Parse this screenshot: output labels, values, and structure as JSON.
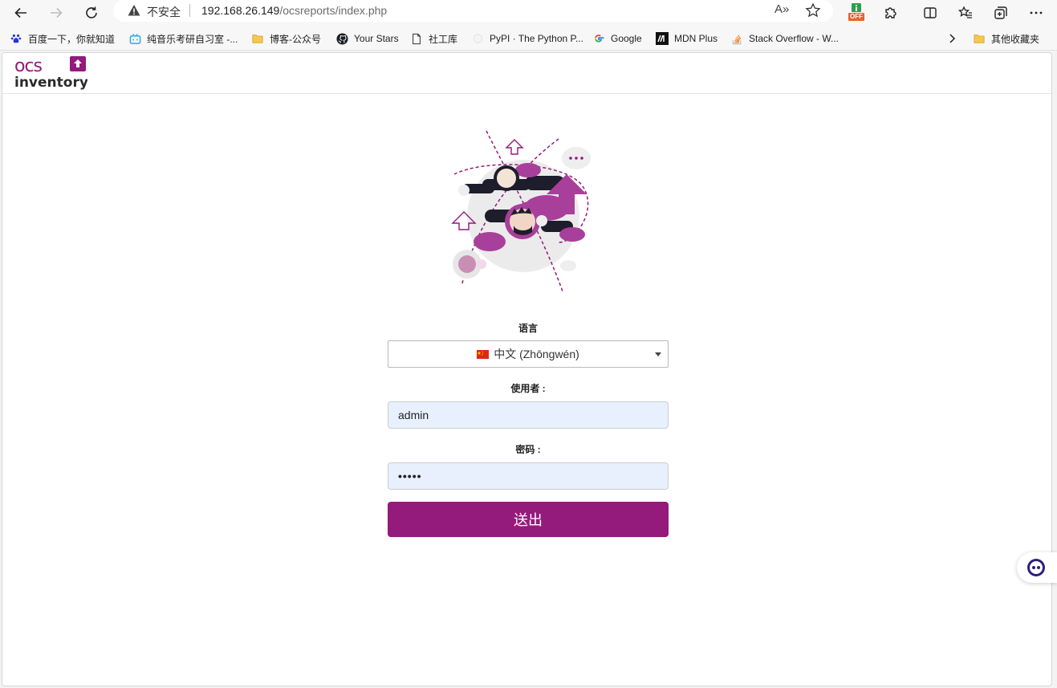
{
  "browser": {
    "security_label": "不安全",
    "url_host": "192.168.26.149",
    "url_path": "/ocsreports/index.php",
    "read_aloud_icon": "A»",
    "extension_badge": "OFF",
    "bookmarks": [
      {
        "label": "百度一下，你就知道",
        "icon": "baidu-icon"
      },
      {
        "label": "纯音乐考研自习室 -...",
        "icon": "bilibili-icon"
      },
      {
        "label": "博客-公众号",
        "icon": "folder-icon"
      },
      {
        "label": "Your Stars",
        "icon": "github-icon"
      },
      {
        "label": "社工库",
        "icon": "page-icon"
      },
      {
        "label": "PyPI · The Python P...",
        "icon": "pypi-icon"
      },
      {
        "label": "Google",
        "icon": "google-icon"
      },
      {
        "label": "MDN Plus",
        "icon": "mdn-icon"
      },
      {
        "label": "Stack Overflow - W...",
        "icon": "stackoverflow-icon"
      }
    ],
    "other_bookmarks": "其他收藏夹"
  },
  "colors": {
    "brand": "#941a7b",
    "input_bg": "#e8f0fe"
  },
  "login": {
    "language_label": "语言",
    "language_value": "中文 (Zhōngwén)",
    "user_label": "使用者 :",
    "user_value": "admin",
    "password_label": "密码 :",
    "password_value": "•••••",
    "submit_label": "送出"
  }
}
